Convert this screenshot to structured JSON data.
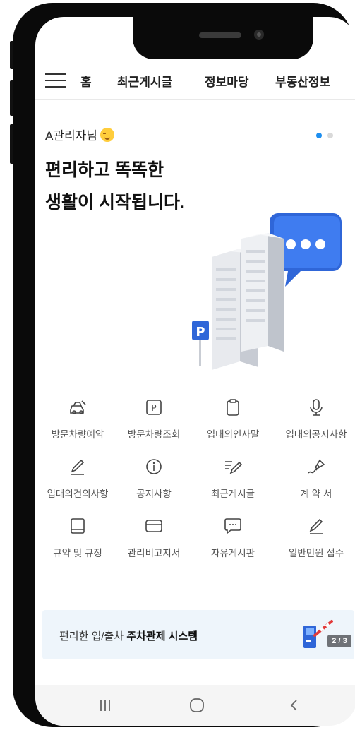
{
  "nav": {
    "items": [
      "홈",
      "최근게시글",
      "정보마당",
      "부동산정보"
    ]
  },
  "hero": {
    "greeting": "A관리자님",
    "headline_line1": "편리하고 똑똑한",
    "headline_line2": "생활이 시작됩니다.",
    "slides_total": 2,
    "slide_active": 1
  },
  "menu": [
    {
      "label": "방문차량예약",
      "icon": "car-icon"
    },
    {
      "label": "방문차량조회",
      "icon": "parking-icon"
    },
    {
      "label": "입대의인사말",
      "icon": "clipboard-icon"
    },
    {
      "label": "입대의공지사항",
      "icon": "microphone-icon"
    },
    {
      "label": "입대의건의사항",
      "icon": "pencil-icon"
    },
    {
      "label": "공지사항",
      "icon": "info-icon"
    },
    {
      "label": "최근게시글",
      "icon": "list-edit-icon"
    },
    {
      "label": "계 약 서",
      "icon": "fountain-pen-icon"
    },
    {
      "label": "규약 및 규정",
      "icon": "book-icon"
    },
    {
      "label": "관리비고지서",
      "icon": "card-icon"
    },
    {
      "label": "자유게시판",
      "icon": "chat-icon"
    },
    {
      "label": "일반민원 접수",
      "icon": "pencil-icon"
    }
  ],
  "banner": {
    "text_prefix": "편리한 입/출차 ",
    "text_bold": "주차관제 시스템",
    "pager": "2 / 3"
  },
  "colors": {
    "accent": "#1e8ff0",
    "banner_bg": "#eef5fb"
  },
  "bottom_nav": [
    "recent-apps-icon",
    "home-icon",
    "back-icon"
  ]
}
